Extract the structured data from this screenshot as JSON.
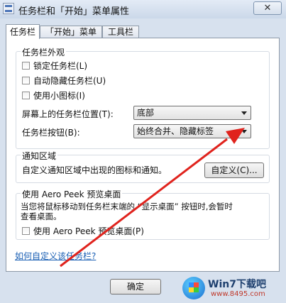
{
  "window": {
    "title": "任务栏和「开始」菜单属性",
    "close_glyph": "✕"
  },
  "tabs": [
    {
      "label": "任务栏"
    },
    {
      "label": "「开始」菜单"
    },
    {
      "label": "工具栏"
    }
  ],
  "appearance": {
    "group_title": "任务栏外观",
    "lock_taskbar": "锁定任务栏(L)",
    "auto_hide": "自动隐藏任务栏(U)",
    "small_icons": "使用小图标(I)",
    "position_label": "屏幕上的任务栏位置(T):",
    "position_value": "底部",
    "buttons_label": "任务栏按钮(B):",
    "buttons_value": "始终合并、隐藏标签"
  },
  "notification": {
    "group_title": "通知区域",
    "description": "自定义通知区域中出现的图标和通知。",
    "customize_button": "自定义(C)..."
  },
  "aero": {
    "group_title": "使用 Aero Peek 预览桌面",
    "description_line1": "当您将鼠标移动到任务栏末端的 “显示桌面” 按钮时,会暂时",
    "description_line2": "查看桌面。",
    "checkbox_label": "使用 Aero Peek 预览桌面(P)"
  },
  "help_link": "如何自定义该任务栏?",
  "footer": {
    "ok_button": "确定"
  },
  "annotation": {
    "arrow_color": "#e0231d"
  },
  "watermark": {
    "site": "Win7下载吧",
    "url": "www.8495.com"
  }
}
